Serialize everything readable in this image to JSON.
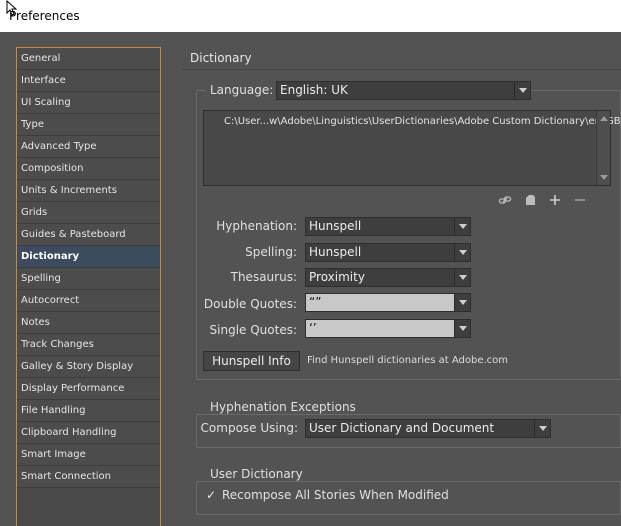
{
  "window": {
    "title": "Preferences"
  },
  "sidebar": {
    "items": [
      {
        "label": "General"
      },
      {
        "label": "Interface"
      },
      {
        "label": "UI Scaling"
      },
      {
        "label": "Type"
      },
      {
        "label": "Advanced Type"
      },
      {
        "label": "Composition"
      },
      {
        "label": "Units & Increments"
      },
      {
        "label": "Grids"
      },
      {
        "label": "Guides & Pasteboard"
      },
      {
        "label": "Dictionary",
        "selected": true
      },
      {
        "label": "Spelling"
      },
      {
        "label": "Autocorrect"
      },
      {
        "label": "Notes"
      },
      {
        "label": "Track Changes"
      },
      {
        "label": "Galley & Story Display"
      },
      {
        "label": "Display Performance"
      },
      {
        "label": "File Handling"
      },
      {
        "label": "Clipboard Handling"
      },
      {
        "label": "Smart Image"
      },
      {
        "label": "Smart Connection"
      }
    ]
  },
  "main": {
    "title": "Dictionary",
    "language": {
      "label": "Language:",
      "value": "English: UK",
      "dictionary_path": "C:\\User...w\\Adobe\\Linguistics\\UserDictionaries\\Adobe Custom Dictionary\\en_GB"
    },
    "icons": [
      "link-icon",
      "new-page-icon",
      "plus-icon",
      "minus-icon"
    ],
    "fields": {
      "hyphenation": {
        "label": "Hyphenation:",
        "value": "Hunspell"
      },
      "spelling": {
        "label": "Spelling:",
        "value": "Hunspell"
      },
      "thesaurus": {
        "label": "Thesaurus:",
        "value": "Proximity"
      },
      "double_quotes": {
        "label": "Double Quotes:",
        "value": "“”"
      },
      "single_quotes": {
        "label": "Single Quotes:",
        "value": "‘’"
      }
    },
    "hunspell_info_button": "Hunspell Info",
    "hunspell_hint": "Find Hunspell dictionaries at Adobe.com",
    "hyphenation_exceptions": {
      "legend": "Hyphenation Exceptions",
      "compose_label": "Compose Using:",
      "compose_value": "User Dictionary and Document"
    },
    "user_dictionary": {
      "legend": "User Dictionary",
      "recompose_label": "Recompose All Stories When Modified",
      "recompose_checked": true
    }
  },
  "colors": {
    "panel_bg": "#535353",
    "sidebar_border": "#c98a3a",
    "selected_bg": "#3d4b5e"
  }
}
